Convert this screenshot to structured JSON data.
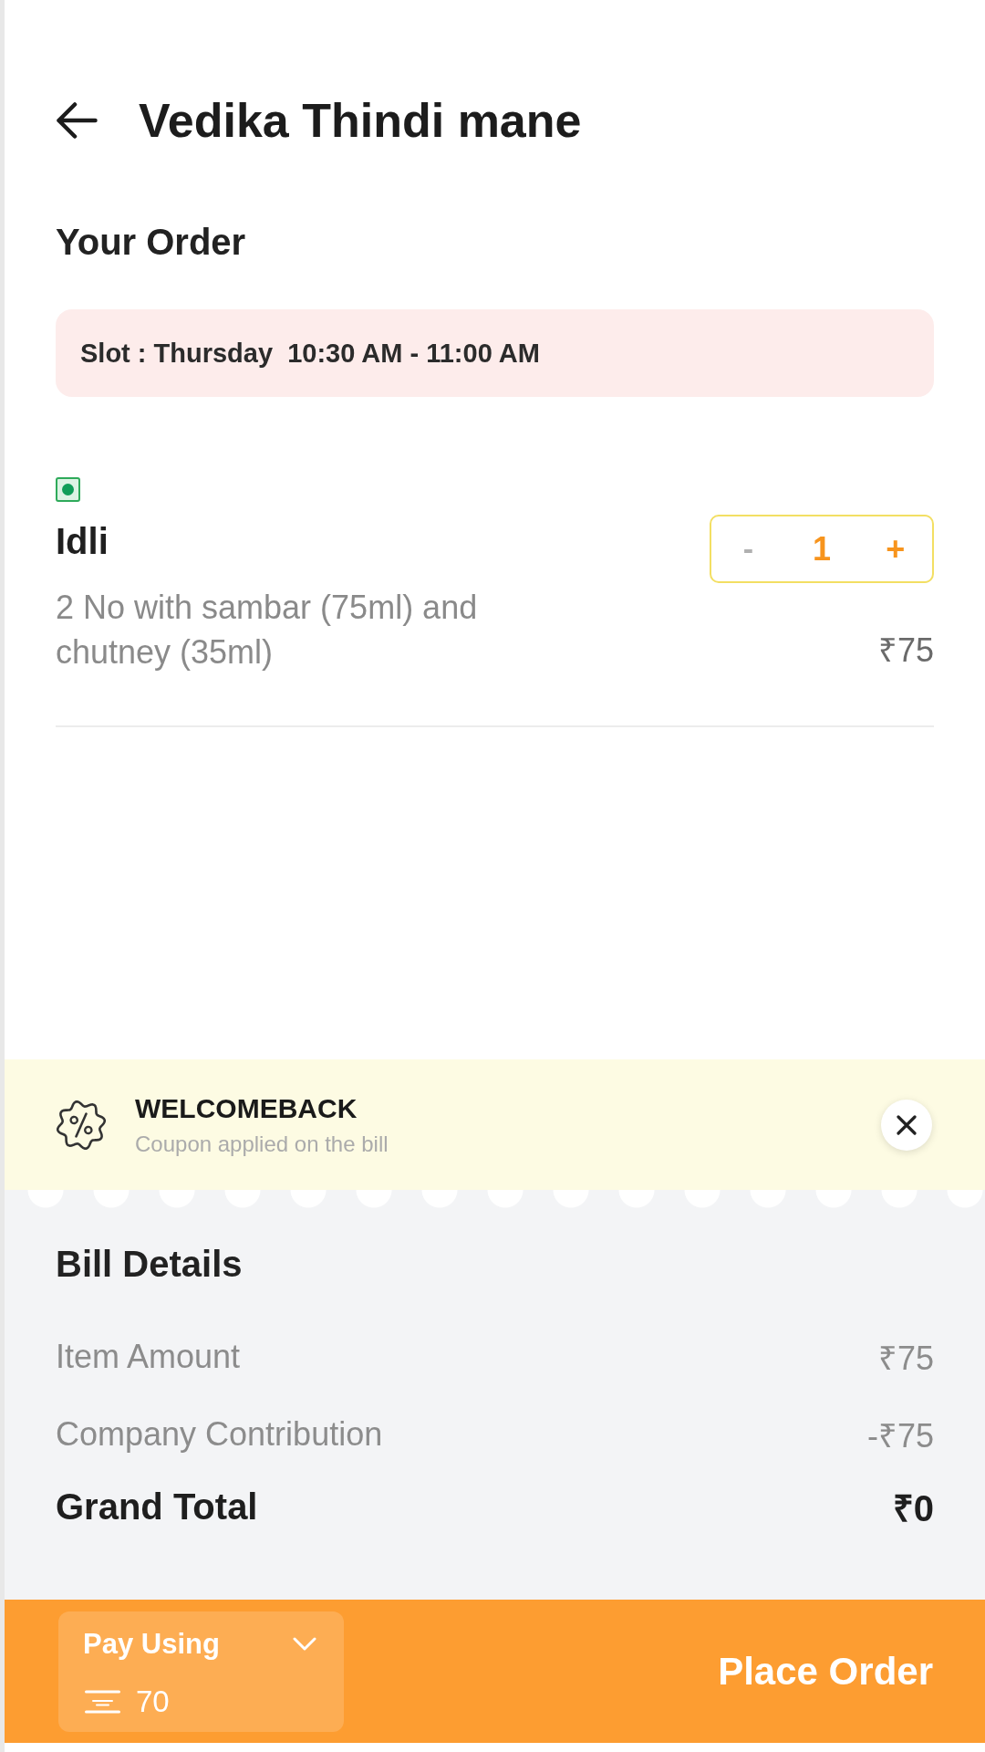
{
  "header": {
    "title": "Vedika Thindi mane"
  },
  "order": {
    "heading": "Your Order",
    "slot": "Slot : Thursday  10:30 AM - 11:00 AM"
  },
  "items": [
    {
      "veg": true,
      "name": "Idli",
      "description": "2 No with sambar (75ml) and chutney (35ml)",
      "decrement": "-",
      "quantity": "1",
      "increment": "+",
      "price": "₹75"
    }
  ],
  "coupon": {
    "code": "WELCOMEBACK",
    "note": "Coupon applied on the bill"
  },
  "bill": {
    "heading": "Bill Details",
    "rows": [
      {
        "kind": "line",
        "label": "Item Amount",
        "amount": "₹75"
      },
      {
        "kind": "line",
        "label": "Company Contribution",
        "amount": "-₹75"
      },
      {
        "kind": "total",
        "label": "Grand Total",
        "amount": "₹0"
      }
    ]
  },
  "footer": {
    "pay_label": "Pay Using",
    "pay_value": "70",
    "action": "Place Order"
  }
}
